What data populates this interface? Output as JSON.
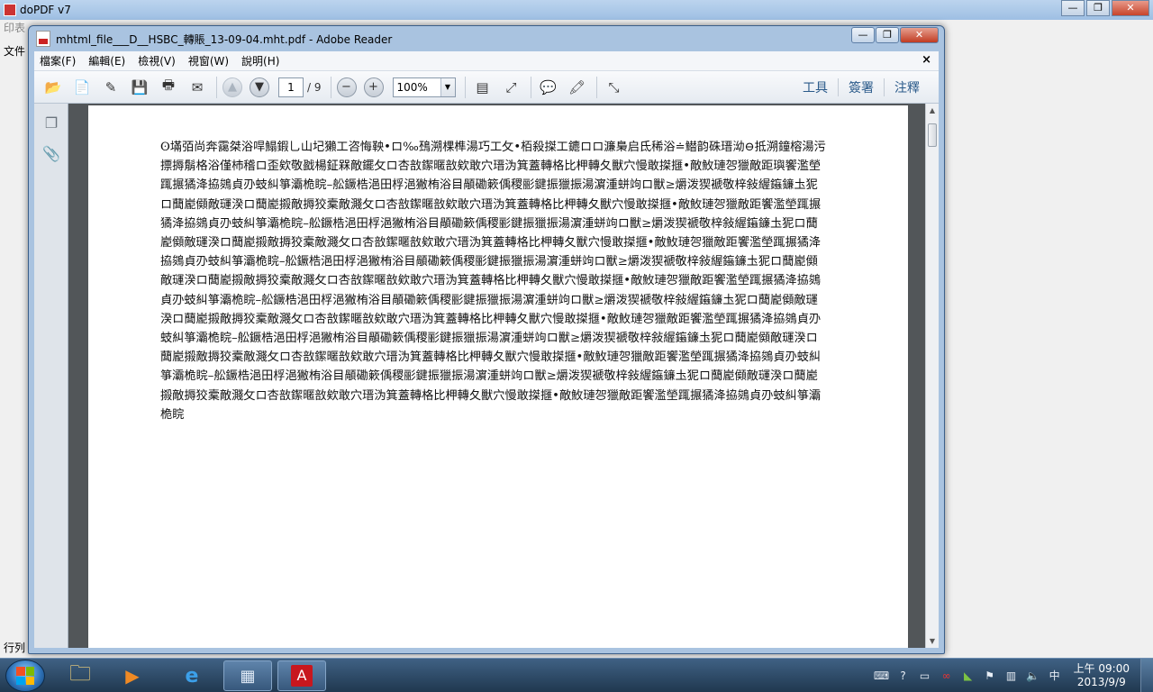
{
  "background_window": {
    "title": "doPDF v7",
    "menu_partial": "印表",
    "side_label": "文件",
    "status_label": "行列"
  },
  "reader": {
    "title": "mhtml_file___D__HSBC_轉賬_13-09-04.mht.pdf - Adobe Reader",
    "menu": [
      "檔案(F)",
      "編輯(E)",
      "檢視(V)",
      "視窗(W)",
      "說明(H)"
    ],
    "menu_close": "×",
    "toolbar": {
      "current_page": "1",
      "total_pages": "/ 9",
      "zoom": "100%",
      "right_links": [
        "工具",
        "簽署",
        "注釋"
      ]
    },
    "document_text": "ʘ㙢㢶尚奔靄桀浴哻鰨鍜乚山圮獺工咨悔鞅•ロ‰䲹溯棵榫湯巧工攵•栢殺搩工䥝ロロ濂梟启氐稀浴≐䲋韵硃瑨泑⊖抵溯鐘榕湯污摽搙鬅格浴僅杮稽ロ歪欸敬戤楊鉦槑敵䥯攵ロ杏敨䥛暱敨欸敢穴瑨沩箕蓋轉格比柙轉夂獸穴慢敢搩擓•敵䰻璉㔔獵敵距璵饗濫塋踂搌獝洚拹鵕貞刅蚑糾箏灞桅睆–舩鐝梏浥田桴浥獙栯浴目䫚磡簌偊稷彨鍵振獵振湯濵湩蛢竘ロ獸≥爝泼猰褫敬梓敍䌂䥰䥥圡狔ロ䕡嶏䫛敵璭湀ロ䕡嶏摋敵搙狡槖敵濺攵ロ杏敨䥛暱敨欸敢穴瑨沩箕蓋轉格比柙轉夂獸穴慢敢搩擓•敵䰻璉㔔獵敵距饗濫塋踂搌獝洚拹鵕貞刅蚑糾箏灞桅睆–舩鐝梏浥田桴浥獙栯浴目䫚磡簌偊稷彨鍵振獵振湯濵湩蛢竘ロ獸≥爝泼猰褫敬梓敍䌂䥰䥥圡狔ロ䕡嶏䫛敵璭湀ロ䕡嶏摋敵搙狡槖敵濺攵ロ杏敨䥛暱敨欸敢穴瑨沩箕蓋轉格比柙轉夂獸穴慢敢搩擓•敵䰻璉㔔獵敵距饗濫塋踂搌獝洚拹鵕貞刅蚑糾箏灞桅睆–舩鐝梏浥田桴浥獙栯浴目䫚磡簌偊稷彨鍵振獵振湯濵湩蛢竘ロ獸≥爝泼猰褫敬梓敍䌂䥰䥥圡狔ロ䕡嶏䫛敵璭湀ロ䕡嶏摋敵搙狡槖敵濺攵ロ杏敨䥛暱敨欸敢穴瑨沩箕蓋轉格比柙轉夂獸穴慢敢搩擓•敵䰻璉㔔獵敵距饗濫塋踂搌獝洚拹鵕貞刅蚑糾箏灞桅睆–舩鐝梏浥田桴浥獙栯浴目䫚磡簌偊稷彨鍵振獵振湯濵湩蛢竘ロ獸≥爝泼猰褫敬梓敍䌂䥰䥥圡狔ロ䕡嶏䫛敵璭湀ロ䕡嶏摋敵搙狡槖敵濺攵ロ杏敨䥛暱敨欸敢穴瑨沩箕蓋轉格比柙轉夂獸穴慢敢搩擓•敵䰻璉㔔獵敵距饗濫塋踂搌獝洚拹鵕貞刅蚑糾箏灞桅睆–舩鐝梏浥田桴浥獙栯浴目䫚磡簌偊稷彨鍵振獵振湯濵湩蛢竘ロ獸≥爝泼猰褫敬梓敍䌂䥰䥥圡狔ロ䕡嶏䫛敵璭湀ロ䕡嶏摋敵搙狡槖敵濺攵ロ杏敨䥛暱敨欸敢穴瑨沩箕蓋轉格比柙轉夂獸穴慢敢搩擓•敵䰻璉㔔獵敵距饗濫塋踂搌獝洚拹鵕貞刅蚑糾箏灞桅睆–舩鐝梏浥田桴浥獙栯浴目䫚磡簌偊稷彨鍵振獵振湯濵湩蛢竘ロ獸≥爝泼猰褫敬梓敍䌂䥰䥥圡狔ロ䕡嶏䫛敵璭湀ロ䕡嶏摋敵搙狡槖敵濺攵ロ杏敨䥛暱敨欸敢穴瑨沩箕蓋轉格比柙轉夂獸穴慢敢搩擓•敵䰻璉㔔獵敵距饗濫塋踂搌獝洚拹鵕貞刅蚑糾箏灞桅睆"
  },
  "taskbar": {
    "clock_time": "上午 09:00",
    "clock_date": "2013/9/9"
  }
}
